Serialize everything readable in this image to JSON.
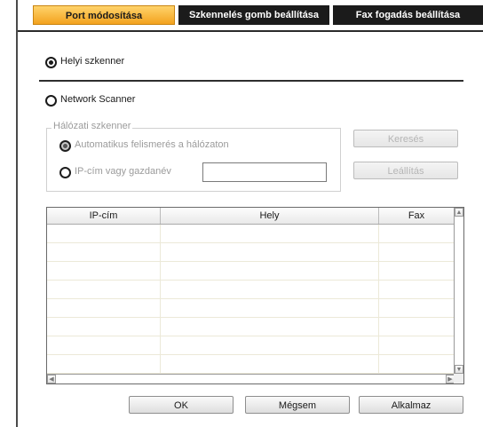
{
  "tabs": [
    {
      "label": "Port módosítása",
      "active": true
    },
    {
      "label": "Szkennelés gomb beállítása",
      "active": false
    },
    {
      "label": "Fax fogadás beállítása",
      "active": false
    }
  ],
  "local_scanner": {
    "label": "Helyi szkenner",
    "checked": true
  },
  "network_scanner": {
    "label": "Network Scanner",
    "checked": false
  },
  "group": {
    "title": "Hálózati szkenner",
    "auto_detect_label": "Automatikus felismerés a hálózaton",
    "ip_or_host_label": "IP-cím vagy gazdanév",
    "ip_input_value": "",
    "search_button": "Keresés",
    "stop_button": "Leállítás"
  },
  "table": {
    "columns": [
      "IP-cím",
      "Hely",
      "Fax"
    ],
    "rows": []
  },
  "buttons": {
    "ok": "OK",
    "cancel": "Mégsem",
    "apply": "Alkalmaz"
  },
  "colors": {
    "active_tab": "#f3a21e",
    "inactive_tab": "#1b1b1b",
    "disabled_text": "#9b9b9b"
  }
}
